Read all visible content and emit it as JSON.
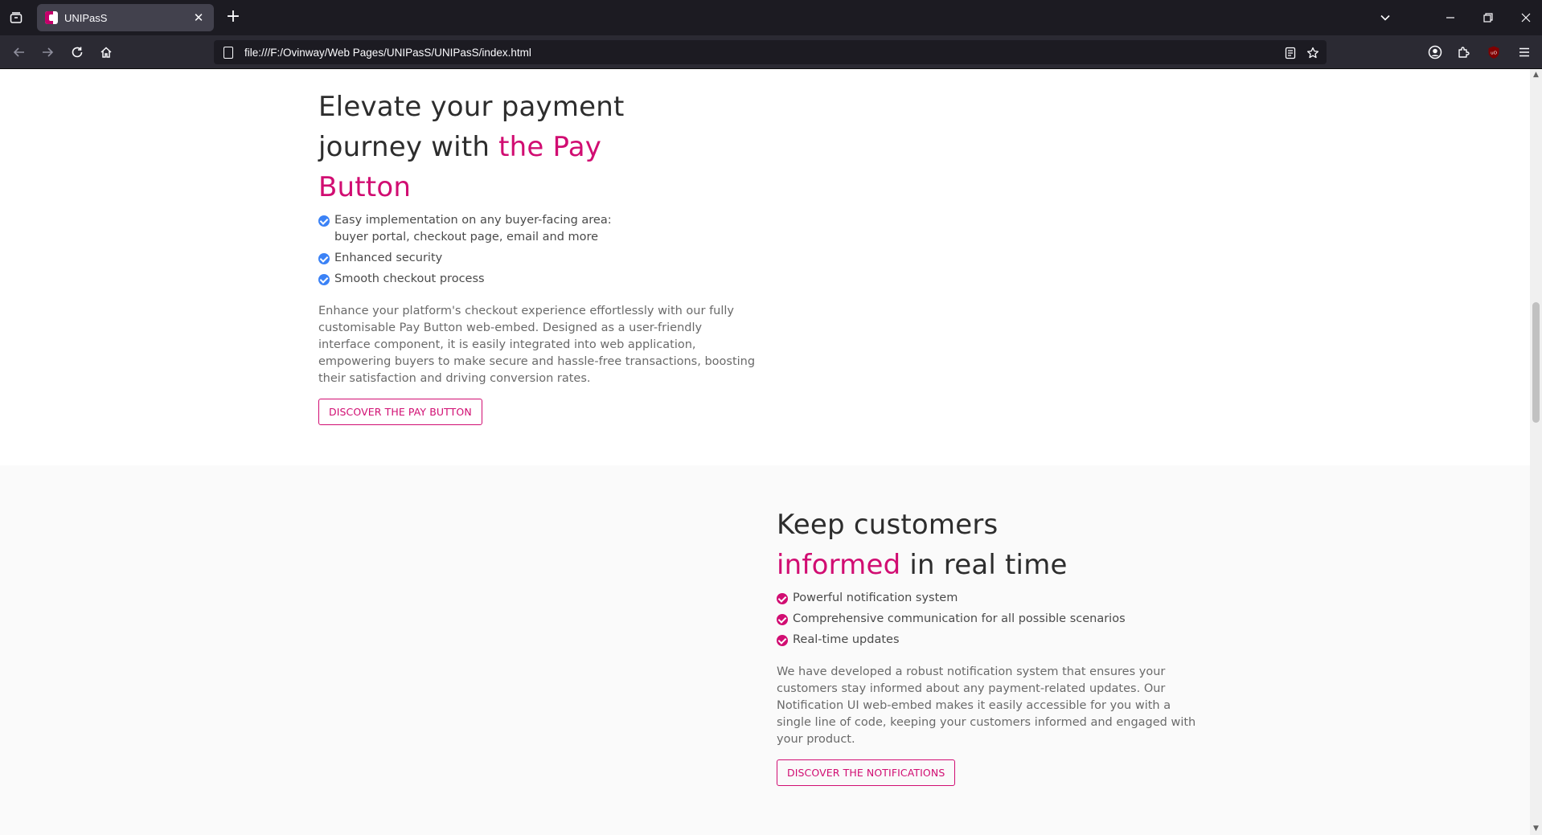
{
  "browser": {
    "tab_title": "UNIPasS",
    "url": "file:///F:/Ovinway/Web Pages/UNIPasS/UNIPasS/index.html"
  },
  "icons": {
    "tab_list": "tab-list-icon",
    "close": "close-icon",
    "new_tab": "plus-icon",
    "back": "arrow-left-icon",
    "forward": "arrow-right-icon",
    "reload": "reload-icon",
    "home": "home-icon",
    "reader": "reader-view-icon",
    "bookmark": "star-icon",
    "account": "account-icon",
    "extensions": "puzzle-icon",
    "ublock": "ublock-origin-icon",
    "menu": "hamburger-menu-icon"
  },
  "colors": {
    "accent": "#d10d72",
    "check_blue": "#3b82f6",
    "chrome_dark": "#1c1b22",
    "toolbar": "#2b2a33"
  },
  "pay_button_section": {
    "headline_line1": "Elevate your payment",
    "headline_line2_plain": "journey with ",
    "headline_line2_accent": "the Pay",
    "headline_line3_accent": "Button",
    "features": [
      "Easy implementation on any buyer-facing area: buyer portal, checkout page, email and more",
      "Enhanced security",
      "Smooth checkout process"
    ],
    "description": "Enhance your platform's checkout experience effortlessly with our fully customisable Pay Button web-embed. Designed as a user-friendly interface component, it is easily integrated into web application, empowering buyers to make secure and hassle-free transactions, boosting their satisfaction and driving conversion rates.",
    "cta_label": "DISCOVER THE PAY BUTTON"
  },
  "notifications_section": {
    "headline_line1": "Keep customers",
    "headline_line2_accent": "informed",
    "headline_line2_plain": " in real time",
    "features": [
      "Powerful notification system",
      "Comprehensive communication for all possible scenarios",
      "Real-time updates"
    ],
    "description": "We have developed a robust notification system that ensures your customers stay informed about any payment-related updates. Our Notification UI web-embed makes it easily accessible for you with a single line of code, keeping your customers informed and engaged with your product.",
    "cta_label": "DISCOVER THE NOTIFICATIONS"
  }
}
